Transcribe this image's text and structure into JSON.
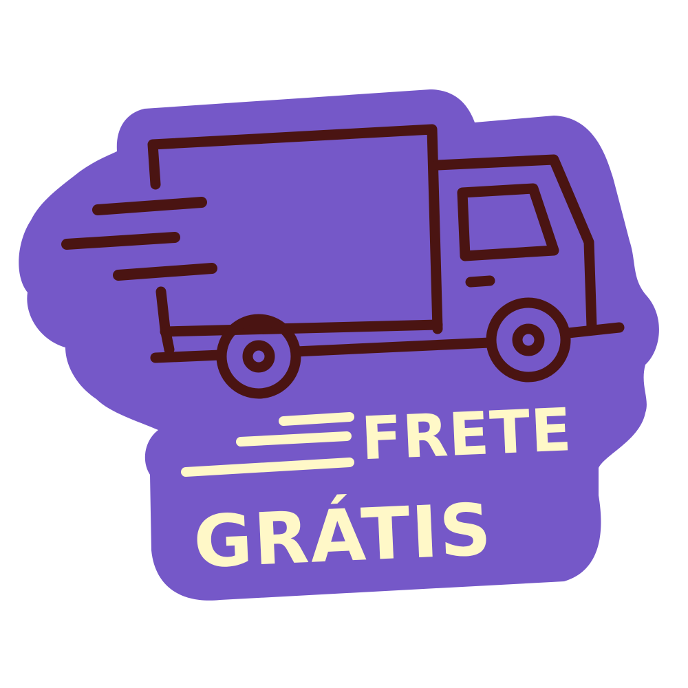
{
  "badge": {
    "line1": "FRETE",
    "line2": "GRÁTIS"
  },
  "icons": {
    "vehicle": "delivery-truck-icon",
    "motion": "speed-lines-icon"
  },
  "colors": {
    "background": "#ffffff",
    "badge_fill": "#7558c8",
    "outline": "#4a1412",
    "text": "#fff8c8"
  }
}
